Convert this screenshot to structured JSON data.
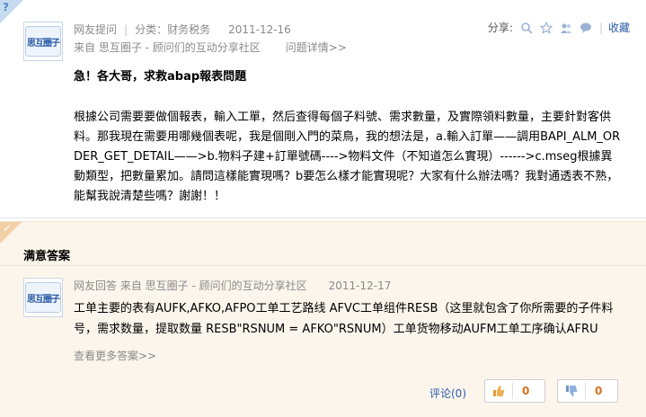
{
  "question": {
    "corner_mark": "?",
    "avatar_text": "思互圈子",
    "source_label": "网友提问",
    "category": "分类：财务税务",
    "date": "2011-12-16",
    "from_line": "来自 思互圈子 - 顾问们的互动分享社区",
    "details_link": "问题详情>>",
    "share_label": "分享:",
    "collect_label": "收藏",
    "title": "急！各大哥，求救abap報表問題",
    "body": "根據公司需要要做個報表，輸入工單，然后查得每個子料號、需求數量，及實際領料數量，主要針對客供料。那我現在需要用哪幾個表呢，我是個剛入門的菜鳥，我的想法是，a.輸入訂單——調用BAPI_ALM_ORDER_GET_DETAIL——>b.物料子建+訂單號碼---->物料文件（不知道怎么實現）------>c.mseg根據異動類型，把數量累加。請問這樣能實現嗎？b要怎么樣才能實現呢？大家有什么辦法嗎？我對通透表不熟，能幫我說清楚些嗎？謝謝！！"
  },
  "answer": {
    "corner_mark": "✓",
    "heading": "满意答案",
    "avatar_text": "思互圈子",
    "meta": "网友回答 来自 思互圈子 - 顾问们的互动分享社区",
    "date": "2011-12-17",
    "body": "工单主要的表有AUFK,AFKO,AFPO工单工艺路线 AFVC工单组件RESB（这里就包含了你所需要的子件料号，需求数量，提取数量 RESB\"RSNUM = AFKO\"RSNUM）工单货物移动AUFM工单工序确认AFRU",
    "more_link": "查看更多答案>>",
    "comment_label": "评论(0)",
    "upvotes": "0",
    "downvotes": "0"
  },
  "colors": {
    "link_blue": "#2b5ba8",
    "meta_gray": "#8a8a8a",
    "answer_bg": "#fbf5ec",
    "vote_orange": "#d8731d"
  },
  "icons": {
    "share": [
      "search-icon",
      "star-icon",
      "people-icon",
      "bubble-icon"
    ],
    "vote": [
      "thumb-up-icon",
      "thumb-down-icon"
    ]
  }
}
